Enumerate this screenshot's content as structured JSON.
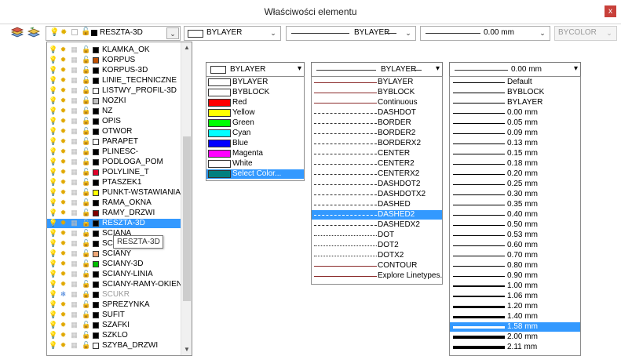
{
  "window": {
    "title": "Właściwości elementu",
    "close_label": "x"
  },
  "toolbar": {
    "layer_value": "RESZTA-3D",
    "color_value": "BYLAYER",
    "linetype_value": "BYLAYER",
    "lineweight_value": "0.00 mm",
    "plotstyle_value": "BYCOLOR",
    "arrow": "⌄"
  },
  "layers": [
    {
      "name": "KLAMKA_OK",
      "color": "#000000",
      "frozen": false,
      "locked": false
    },
    {
      "name": "KORPUS",
      "color": "#c05000",
      "frozen": false,
      "locked": false
    },
    {
      "name": "KORPUS-3D",
      "color": "#000000",
      "frozen": false,
      "locked": false
    },
    {
      "name": "LINIE_TECHNICZNE",
      "color": "#000000",
      "frozen": false,
      "locked": false
    },
    {
      "name": "LISTWY_PROFIL-3D",
      "color": "#ffffff",
      "frozen": false,
      "locked": false
    },
    {
      "name": "NOZKI",
      "color": "#c0c0c0",
      "frozen": false,
      "locked": false
    },
    {
      "name": "NZ",
      "color": "#000000",
      "frozen": false,
      "locked": false
    },
    {
      "name": "OPIS",
      "color": "#000000",
      "frozen": false,
      "locked": false
    },
    {
      "name": "OTWOR",
      "color": "#000000",
      "frozen": false,
      "locked": false
    },
    {
      "name": "PARAPET",
      "color": "#ffffff",
      "frozen": false,
      "locked": false
    },
    {
      "name": "PLINESC-",
      "color": "#000000",
      "frozen": false,
      "locked": false
    },
    {
      "name": "PODLOGA_POM",
      "color": "#000000",
      "frozen": false,
      "locked": false
    },
    {
      "name": "POLYLINE_T",
      "color": "#e0002a",
      "frozen": false,
      "locked": false
    },
    {
      "name": "PTASZEK1",
      "color": "#000000",
      "frozen": false,
      "locked": false
    },
    {
      "name": "PUNKT-WSTAWIANIA",
      "color": "#ffff00",
      "frozen": false,
      "locked": false
    },
    {
      "name": "RAMA_OKNA",
      "color": "#000000",
      "frozen": false,
      "locked": false
    },
    {
      "name": "RAMY_DRZWI",
      "color": "#800000",
      "frozen": false,
      "locked": false
    },
    {
      "name": "RESZTA-3D",
      "color": "#000000",
      "frozen": false,
      "locked": false
    },
    {
      "name": "SCIANA",
      "color": "#000000",
      "frozen": false,
      "locked": false
    },
    {
      "name": "SC",
      "color": "#000000",
      "frozen": false,
      "locked": false
    },
    {
      "name": "SCIANY",
      "color": "#f0a878",
      "frozen": false,
      "locked": false
    },
    {
      "name": "SCIANY-3D",
      "color": "#00c000",
      "frozen": false,
      "locked": false
    },
    {
      "name": "SCIANY-LINIA",
      "color": "#000000",
      "frozen": false,
      "locked": false
    },
    {
      "name": "SCIANY-RAMY-OKIEN",
      "color": "#000000",
      "frozen": false,
      "locked": false
    },
    {
      "name": "SCUKR",
      "color": "#000000",
      "frozen": true,
      "locked": true
    },
    {
      "name": "SPREZYNKA",
      "color": "#000000",
      "frozen": false,
      "locked": false
    },
    {
      "name": "SUFIT",
      "color": "#000000",
      "frozen": false,
      "locked": false
    },
    {
      "name": "SZAFKI",
      "color": "#000000",
      "frozen": false,
      "locked": false
    },
    {
      "name": "SZKLO",
      "color": "#000000",
      "frozen": false,
      "locked": false
    },
    {
      "name": "SZYBA_DRZWI",
      "color": "#ffffff",
      "frozen": false,
      "locked": false
    }
  ],
  "layer_selected_index": 17,
  "layer_tooltip": "RESZTA-3D",
  "color_dropdown": {
    "header": "BYLAYER",
    "items": [
      {
        "label": "BYLAYER",
        "color": "#ffffff"
      },
      {
        "label": "BYBLOCK",
        "color": "#ffffff"
      },
      {
        "label": "Red",
        "color": "#ff0000"
      },
      {
        "label": "Yellow",
        "color": "#ffff00"
      },
      {
        "label": "Green",
        "color": "#00ff00"
      },
      {
        "label": "Cyan",
        "color": "#00ffff"
      },
      {
        "label": "Blue",
        "color": "#0000ff"
      },
      {
        "label": "Magenta",
        "color": "#ff00ff"
      },
      {
        "label": "White",
        "color": "#ffffff"
      },
      {
        "label": "Select Color...",
        "color": "#008080"
      }
    ],
    "selected_index": 9
  },
  "linetype_dropdown": {
    "header": "BYLAYER",
    "items": [
      {
        "label": "BYLAYER",
        "style": "solid"
      },
      {
        "label": "BYBLOCK",
        "style": "solid"
      },
      {
        "label": "Continuous",
        "style": "solid"
      },
      {
        "label": "DASHDOT",
        "style": "dashdot"
      },
      {
        "label": "BORDER",
        "style": "dashdot"
      },
      {
        "label": "BORDER2",
        "style": "dashdot"
      },
      {
        "label": "BORDERX2",
        "style": "dashdot"
      },
      {
        "label": "CENTER",
        "style": "dashdot"
      },
      {
        "label": "CENTER2",
        "style": "dashdot"
      },
      {
        "label": "CENTERX2",
        "style": "dashdot"
      },
      {
        "label": "DASHDOT2",
        "style": "dashdot"
      },
      {
        "label": "DASHDOTX2",
        "style": "dashdot"
      },
      {
        "label": "DASHED",
        "style": "dashed"
      },
      {
        "label": "DASHED2",
        "style": "dashed"
      },
      {
        "label": "DASHEDX2",
        "style": "dashed"
      },
      {
        "label": "DOT",
        "style": "dotted"
      },
      {
        "label": "DOT2",
        "style": "dotted"
      },
      {
        "label": "DOTX2",
        "style": "dotted"
      },
      {
        "label": "CONTOUR",
        "style": "solid"
      },
      {
        "label": "Explore Linetypes...",
        "style": "solid"
      }
    ],
    "selected_index": 13
  },
  "lineweight_dropdown": {
    "header": "0.00 mm",
    "items": [
      {
        "label": "Default",
        "w": 1
      },
      {
        "label": "BYBLOCK",
        "w": 1
      },
      {
        "label": "BYLAYER",
        "w": 1
      },
      {
        "label": "0.00 mm",
        "w": 1
      },
      {
        "label": "0.05 mm",
        "w": 1
      },
      {
        "label": "0.09 mm",
        "w": 1
      },
      {
        "label": "0.13 mm",
        "w": 1
      },
      {
        "label": "0.15 mm",
        "w": 1
      },
      {
        "label": "0.18 mm",
        "w": 1
      },
      {
        "label": "0.20 mm",
        "w": 1
      },
      {
        "label": "0.25 mm",
        "w": 1
      },
      {
        "label": "0.30 mm",
        "w": 1
      },
      {
        "label": "0.35 mm",
        "w": 1
      },
      {
        "label": "0.40 mm",
        "w": 1
      },
      {
        "label": "0.50 mm",
        "w": 1
      },
      {
        "label": "0.53 mm",
        "w": 1
      },
      {
        "label": "0.60 mm",
        "w": 1
      },
      {
        "label": "0.70 mm",
        "w": 1
      },
      {
        "label": "0.80 mm",
        "w": 1
      },
      {
        "label": "0.90 mm",
        "w": 1
      },
      {
        "label": "1.00 mm",
        "w": 2
      },
      {
        "label": "1.06 mm",
        "w": 2
      },
      {
        "label": "1.20 mm",
        "w": 3
      },
      {
        "label": "1.40 mm",
        "w": 3
      },
      {
        "label": "1.58 mm",
        "w": 3
      },
      {
        "label": "2.00 mm",
        "w": 4
      },
      {
        "label": "2.11 mm",
        "w": 4
      }
    ],
    "selected_index": 24
  }
}
